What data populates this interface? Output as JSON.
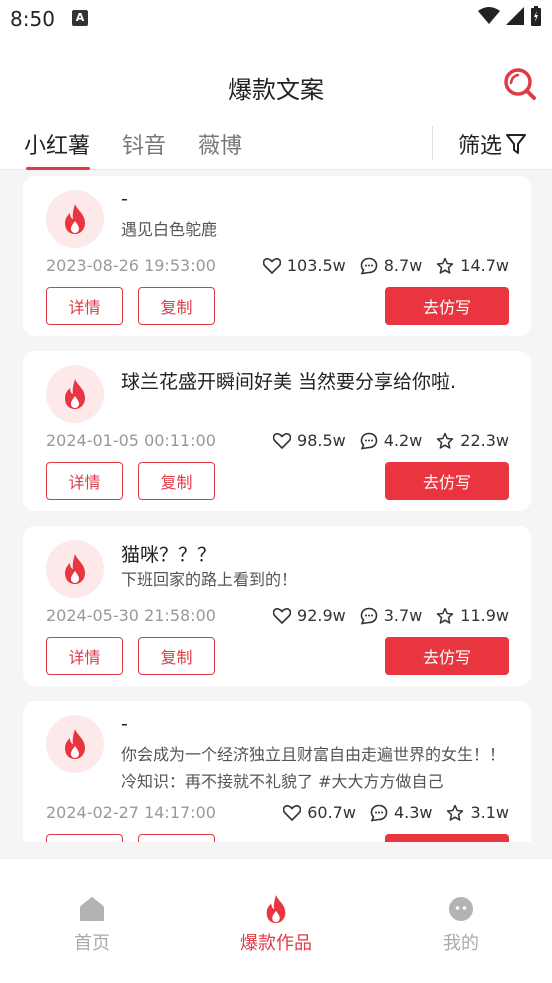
{
  "status": {
    "time": "8:50",
    "app_icon": "A"
  },
  "header": {
    "title": "爆款文案",
    "tabs": [
      "小红薯",
      "钭音",
      "薇博"
    ],
    "filter_label": "筛选"
  },
  "cards": [
    {
      "title": "-",
      "desc": "遇见白色鸵鹿",
      "date": "2023-08-26 19:53:00",
      "likes": "103.5w",
      "comments": "8.7w",
      "favorites": "14.7w"
    },
    {
      "title": "球兰花盛开瞬间好美 当然要分享给你啦.",
      "desc": "",
      "date": "2024-01-05 00:11:00",
      "likes": "98.5w",
      "comments": "4.2w",
      "favorites": "22.3w"
    },
    {
      "title": "猫咪？？？",
      "desc": "下班回家的路上看到的！",
      "date": "2024-05-30 21:58:00",
      "likes": "92.9w",
      "comments": "3.7w",
      "favorites": "11.9w"
    },
    {
      "title": "-",
      "desc": "你会成为一个经济独立且财富自由走遍世界的女生！！ 冷知识：再不接就不礼貌了 #大大方方做自己",
      "date": "2024-02-27 14:17:00",
      "likes": "60.7w",
      "comments": "4.3w",
      "favorites": "3.1w"
    }
  ],
  "buttons": {
    "detail": "详情",
    "copy": "复制",
    "imitate": "去仿写"
  },
  "bottom_nav": [
    {
      "label": "首页",
      "icon": "home-icon"
    },
    {
      "label": "爆款作品",
      "icon": "flame-icon"
    },
    {
      "label": "我的",
      "icon": "profile-icon"
    }
  ],
  "colors": {
    "accent": "#e8353f",
    "avatar_bg": "#fde9ea"
  }
}
